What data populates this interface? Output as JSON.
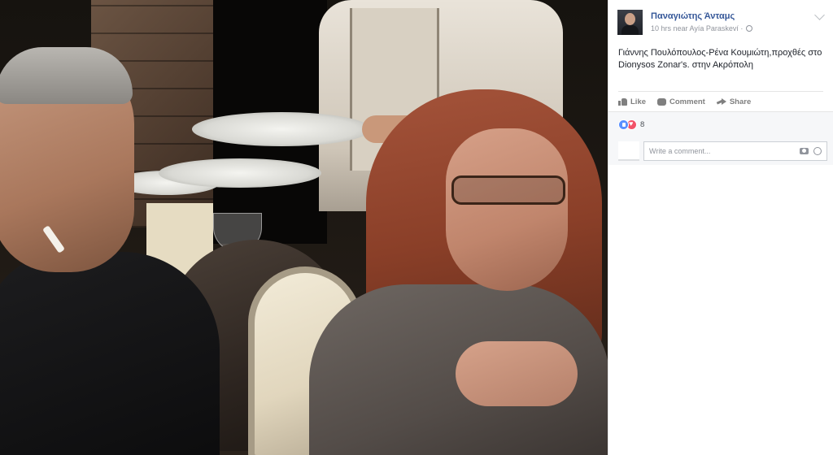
{
  "photo": {
    "description_icon": "photo-viewer-image"
  },
  "post": {
    "author": "Παναγιώτης Άνταμς",
    "meta": "10 hrs near Ayía Paraskeví ·",
    "text": "Γιάννης Πουλόπουλος-Ρένα Κουμιώτη,προχθές στο Dionysos Zonar's. στην Ακρόπολη"
  },
  "actions": {
    "like": "Like",
    "comment": "Comment",
    "share": "Share"
  },
  "feedback": {
    "reaction_count": "8",
    "comment_placeholder": "Write a comment..."
  },
  "colors": {
    "link": "#365899",
    "meta": "#90949c",
    "like_reaction": "#5890ff",
    "love_reaction": "#f25268"
  }
}
